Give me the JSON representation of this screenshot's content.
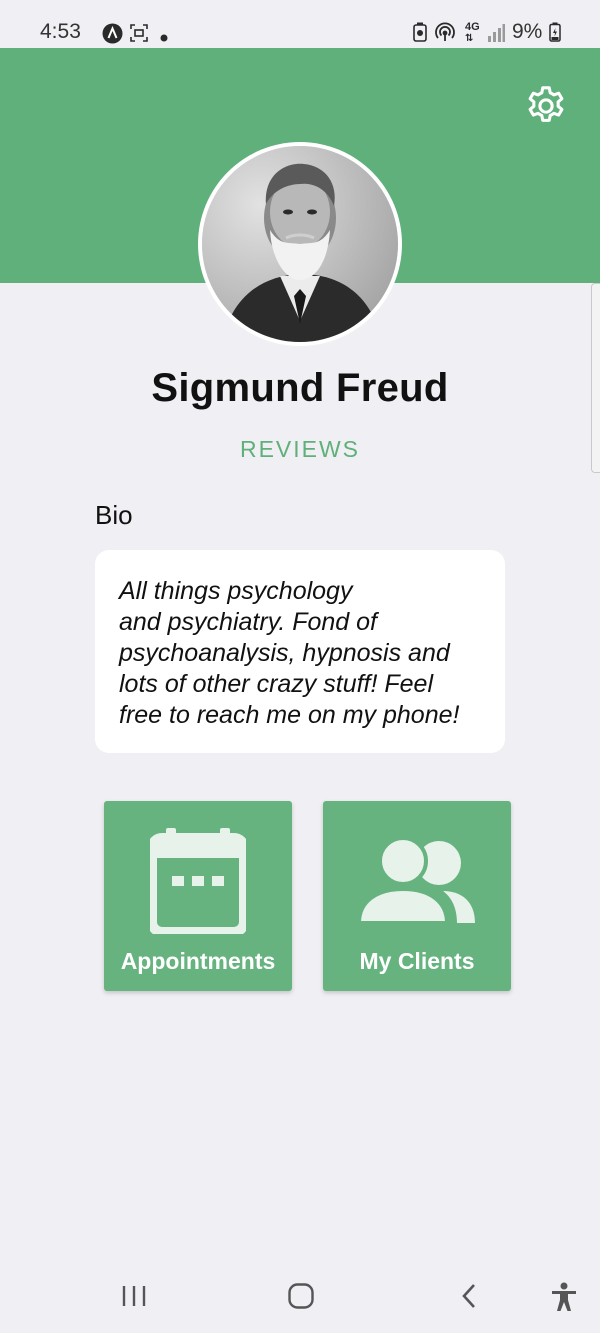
{
  "status_bar": {
    "time": "4:53",
    "battery": "9%",
    "icons": [
      "app-a-icon",
      "screenshot-icon",
      "dot-icon",
      "battery-saver-icon",
      "hotspot-icon",
      "4g-icon",
      "signal-icon",
      "battery-icon"
    ],
    "network_label": "4G"
  },
  "header": {
    "settings_icon": "gear-icon",
    "accent_color": "#5fb07a"
  },
  "profile": {
    "name": "Sigmund Freud",
    "reviews_label": "REVIEWS"
  },
  "bio": {
    "title": "Bio",
    "text": "All things psychology\nand psychiatry. Fond of\npsychoanalysis, hypnosis and\nlots of other crazy stuff! Feel\nfree to reach me on my phone!"
  },
  "actions": [
    {
      "label": "Appointments",
      "icon": "calendar-icon"
    },
    {
      "label": "My Clients",
      "icon": "users-icon"
    }
  ],
  "nav_bar": {
    "icons": [
      "recent-apps-icon",
      "home-icon",
      "back-icon",
      "accessibility-icon"
    ]
  }
}
